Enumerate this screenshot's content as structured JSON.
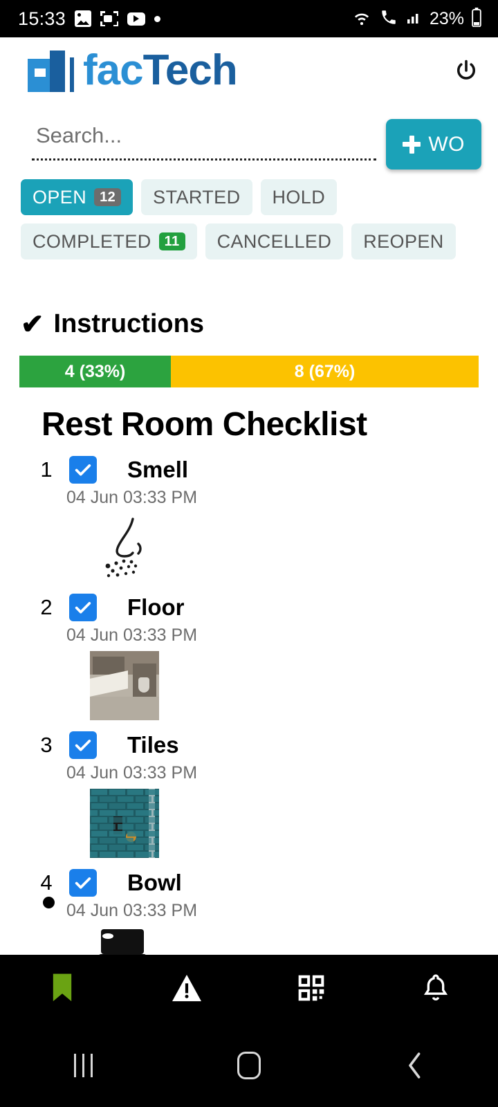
{
  "status_bar": {
    "time": "15:33",
    "battery": "23%",
    "icons": [
      "photo-icon",
      "screen-record-icon",
      "youtube-icon",
      "dot-icon"
    ],
    "right_icons": [
      "wifi-icon",
      "call-wifi-icon",
      "signal-icon",
      "battery-icon"
    ]
  },
  "header": {
    "logo_part1": "fac",
    "logo_part2": "Tech",
    "power_label": "power-icon"
  },
  "search": {
    "placeholder": "Search...",
    "value": "",
    "create_button": "WO"
  },
  "tabs": [
    {
      "label": "OPEN",
      "count": "12",
      "active": true,
      "badge_color": "#6d6d6d"
    },
    {
      "label": "STARTED",
      "count": "",
      "active": false,
      "badge_color": ""
    },
    {
      "label": "HOLD",
      "count": "",
      "active": false,
      "badge_color": ""
    },
    {
      "label": "COMPLETED",
      "count": "11",
      "active": false,
      "badge_color": "#22a03f"
    },
    {
      "label": "CANCELLED",
      "count": "",
      "active": false,
      "badge_color": ""
    },
    {
      "label": "REOPEN",
      "count": "",
      "active": false,
      "badge_color": ""
    }
  ],
  "instructions": {
    "check_glyph": "✔",
    "title": "Instructions"
  },
  "progress": {
    "done_label": "4 (33%)",
    "pending_label": "8 (67%)",
    "done_percent": 33,
    "pending_percent": 67,
    "done_color": "#2ca33f",
    "pending_color": "#fcc200"
  },
  "checklist": {
    "title": "Rest Room Checklist",
    "items": [
      {
        "num": "1",
        "label": "Smell",
        "time": "04 Jun 03:33 PM",
        "checked": true,
        "media": "nose-smell-illustration"
      },
      {
        "num": "2",
        "label": "Floor",
        "time": "04 Jun 03:33 PM",
        "checked": true,
        "media": "restroom-floor-photo"
      },
      {
        "num": "3",
        "label": "Tiles",
        "time": "04 Jun 03:33 PM",
        "checked": true,
        "media": "teal-tile-shower-photo"
      },
      {
        "num": "4",
        "label": "Bowl",
        "time": "04 Jun 03:33 PM",
        "checked": true,
        "media": "toilet-bowl-illustration"
      }
    ]
  },
  "bottom_nav": [
    {
      "icon": "bookmark-icon",
      "color": "#6aa313"
    },
    {
      "icon": "warning-triangle-icon",
      "color": "#ffffff"
    },
    {
      "icon": "qr-code-icon",
      "color": "#ffffff"
    },
    {
      "icon": "bell-icon",
      "color": "#ffffff"
    }
  ],
  "system_nav": [
    {
      "icon": "recents-icon"
    },
    {
      "icon": "home-icon"
    },
    {
      "icon": "back-icon"
    }
  ]
}
